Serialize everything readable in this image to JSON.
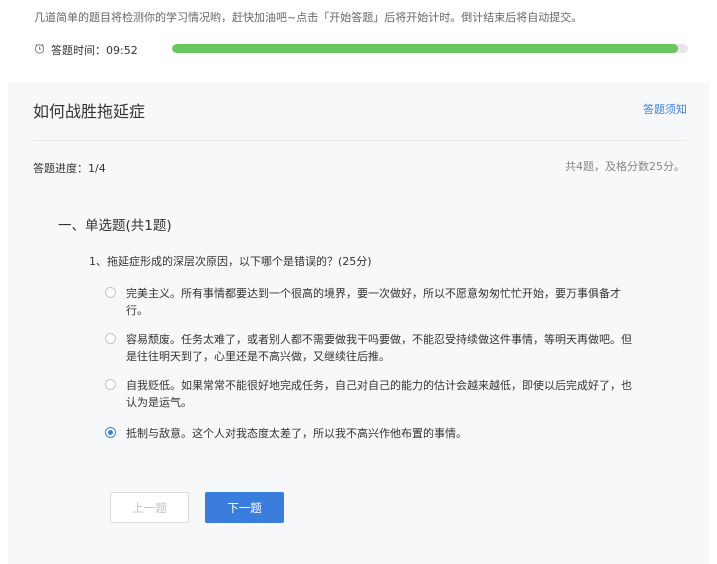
{
  "intro": "几道简单的题目将检测你的学习情况哟，赶快加油吧~点击「开始答题」后将开始计时。倒计结束后将自动提交。",
  "timer": {
    "label": "答题时间：09:52",
    "progress": 0.98,
    "icon": "clock-icon",
    "color": "#6cc660"
  },
  "quiz": {
    "title": "如何战胜拖延症",
    "notice_link": "答题须知",
    "progress_text": "答题进度：1/4",
    "summary": "共4题，及格分数25分。",
    "section_title": "一、单选题(共1题)",
    "question": "1、拖延症形成的深层次原因，以下哪个是错误的？(25分)",
    "options": [
      {
        "text": "完美主义。所有事情都要达到一个很高的境界，要一次做好，所以不愿意匆匆忙忙开始，要万事俱备才行。",
        "selected": false
      },
      {
        "text": "容易颓废。任务太难了，或者别人都不需要做我干吗要做，不能忍受持续做这件事情，等明天再做吧。但是往往明天到了，心里还是不高兴做，又继续往后推。",
        "selected": false
      },
      {
        "text": "自我贬低。如果常常不能很好地完成任务，自己对自己的能力的估计会越来越低，即使以后完成好了，也认为是运气。",
        "selected": false
      },
      {
        "text": "抵制与敌意。这个人对我态度太差了，所以我不高兴作他布置的事情。",
        "selected": true
      }
    ],
    "prev_button": "上一题",
    "next_button": "下一题"
  },
  "colors": {
    "accent": "#3a82e0",
    "button": "#3b7ddd",
    "card_bg": "#f7f8fa"
  }
}
